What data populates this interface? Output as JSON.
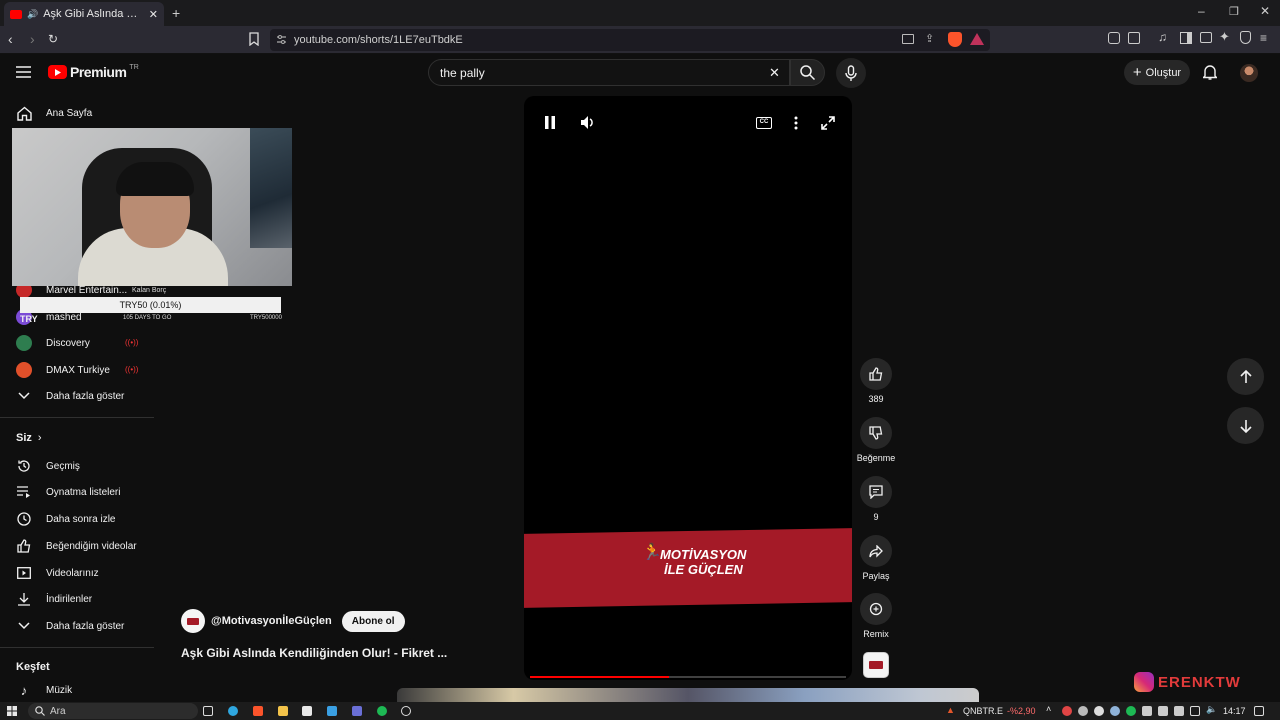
{
  "browser": {
    "tab_title": "Aşk Gibi Aslında Kendiliğinden Olur!",
    "url": "youtube.com/shorts/1LE7euTbdkE"
  },
  "header": {
    "logo_text": "Premium",
    "logo_badge": "TR",
    "search_value": "the pally",
    "create_label": "Oluştur"
  },
  "sidebar": {
    "home_label": "Ana Sayfa",
    "subscriptions": [
      {
        "name": "Marvel Entertain...",
        "live": false,
        "color": "#c62828"
      },
      {
        "name": "mashed",
        "live": false,
        "color": "#7b4bd6"
      },
      {
        "name": "Discovery",
        "live": true,
        "color": "#2e7d4f"
      },
      {
        "name": "DMAX Turkiye",
        "live": true,
        "color": "#e0502a"
      }
    ],
    "show_more_subs": "Daha fazla göster",
    "you_section": "Siz",
    "you_items": [
      {
        "label": "Geçmiş",
        "icon": "history-icon"
      },
      {
        "label": "Oynatma listeleri",
        "icon": "playlist-icon"
      },
      {
        "label": "Daha sonra izle",
        "icon": "clock-icon"
      },
      {
        "label": "Beğendiğim videolar",
        "icon": "thumbs-up-icon"
      },
      {
        "label": "Videolarınız",
        "icon": "video-icon"
      },
      {
        "label": "İndirilenler",
        "icon": "download-icon"
      }
    ],
    "show_more_you": "Daha fazla göster",
    "explore_section": "Keşfet",
    "explore_items": [
      {
        "label": "Müzik",
        "icon": "music-note-icon"
      }
    ]
  },
  "overlay": {
    "donation_label": "Kalan Borç",
    "currency": "TRY",
    "donation_value": "TRY50 (0.01%)",
    "days_to_go": "105 DAYS TO GO",
    "goal": "TRY500000"
  },
  "short": {
    "banner_line1": "MOTİVASYON",
    "banner_line2": "İLE GÜÇLEN",
    "channel": "@MotivasyonİleGüçlen",
    "subscribe_label": "Abone ol",
    "title": "Aşk Gibi Aslında Kendiliğinden Olur! - Fikret ...",
    "progress": 0.44,
    "likes": "389",
    "dislike_label": "Beğenme",
    "comments": "9",
    "share_label": "Paylaş",
    "remix_label": "Remix"
  },
  "watermark": "ERENKTW",
  "taskbar": {
    "search_placeholder": "Ara",
    "ticker_name": "QNBTR.E",
    "ticker_change": "-%2,90",
    "time": "14:17"
  },
  "colors": {
    "accent_red": "#ff0000",
    "banner_red": "#a41a27"
  }
}
